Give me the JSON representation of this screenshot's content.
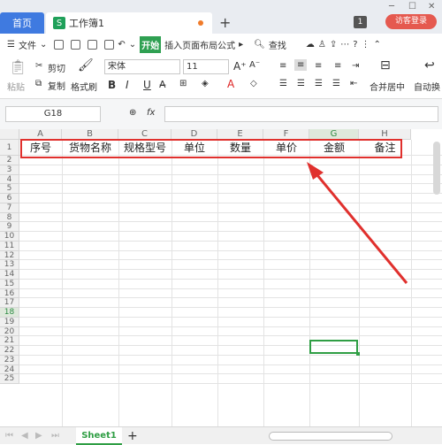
{
  "tabs": {
    "home": "首页",
    "doc": "工作簿1",
    "doc_icon": "S",
    "badge": "1",
    "login": "访客登录"
  },
  "menu": {
    "file": "文件",
    "start": "开始",
    "insert": "插入",
    "layout": "页面布局",
    "formula": "公式",
    "search": "查找"
  },
  "ribbon": {
    "paste": "粘贴",
    "cut": "剪切",
    "copy": "复制",
    "format_painter": "格式刷",
    "font": "宋体",
    "size": "11",
    "bold": "B",
    "italic": "I",
    "underline": "U",
    "merge": "合并居中",
    "autowrap": "自动换"
  },
  "formula_bar": {
    "cell": "G18",
    "fx": "fx"
  },
  "columns": [
    "A",
    "B",
    "C",
    "D",
    "E",
    "F",
    "G",
    "H"
  ],
  "rows": [
    "1",
    "2",
    "3",
    "4",
    "5",
    "6",
    "7",
    "8",
    "9",
    "10",
    "11",
    "12",
    "13",
    "14",
    "15",
    "16",
    "17",
    "18",
    "19",
    "20",
    "21",
    "22",
    "23",
    "24",
    "25"
  ],
  "header_cells": [
    "序号",
    "货物名称",
    "规格型号",
    "单位",
    "数量",
    "单价",
    "金额",
    "备注"
  ],
  "selected": {
    "column": "G",
    "row": "18"
  },
  "sheet_tab": "Sheet1",
  "colors": {
    "accent": "#2fa052",
    "highlight": "#e0302d",
    "home_tab": "#3f7ae0"
  }
}
